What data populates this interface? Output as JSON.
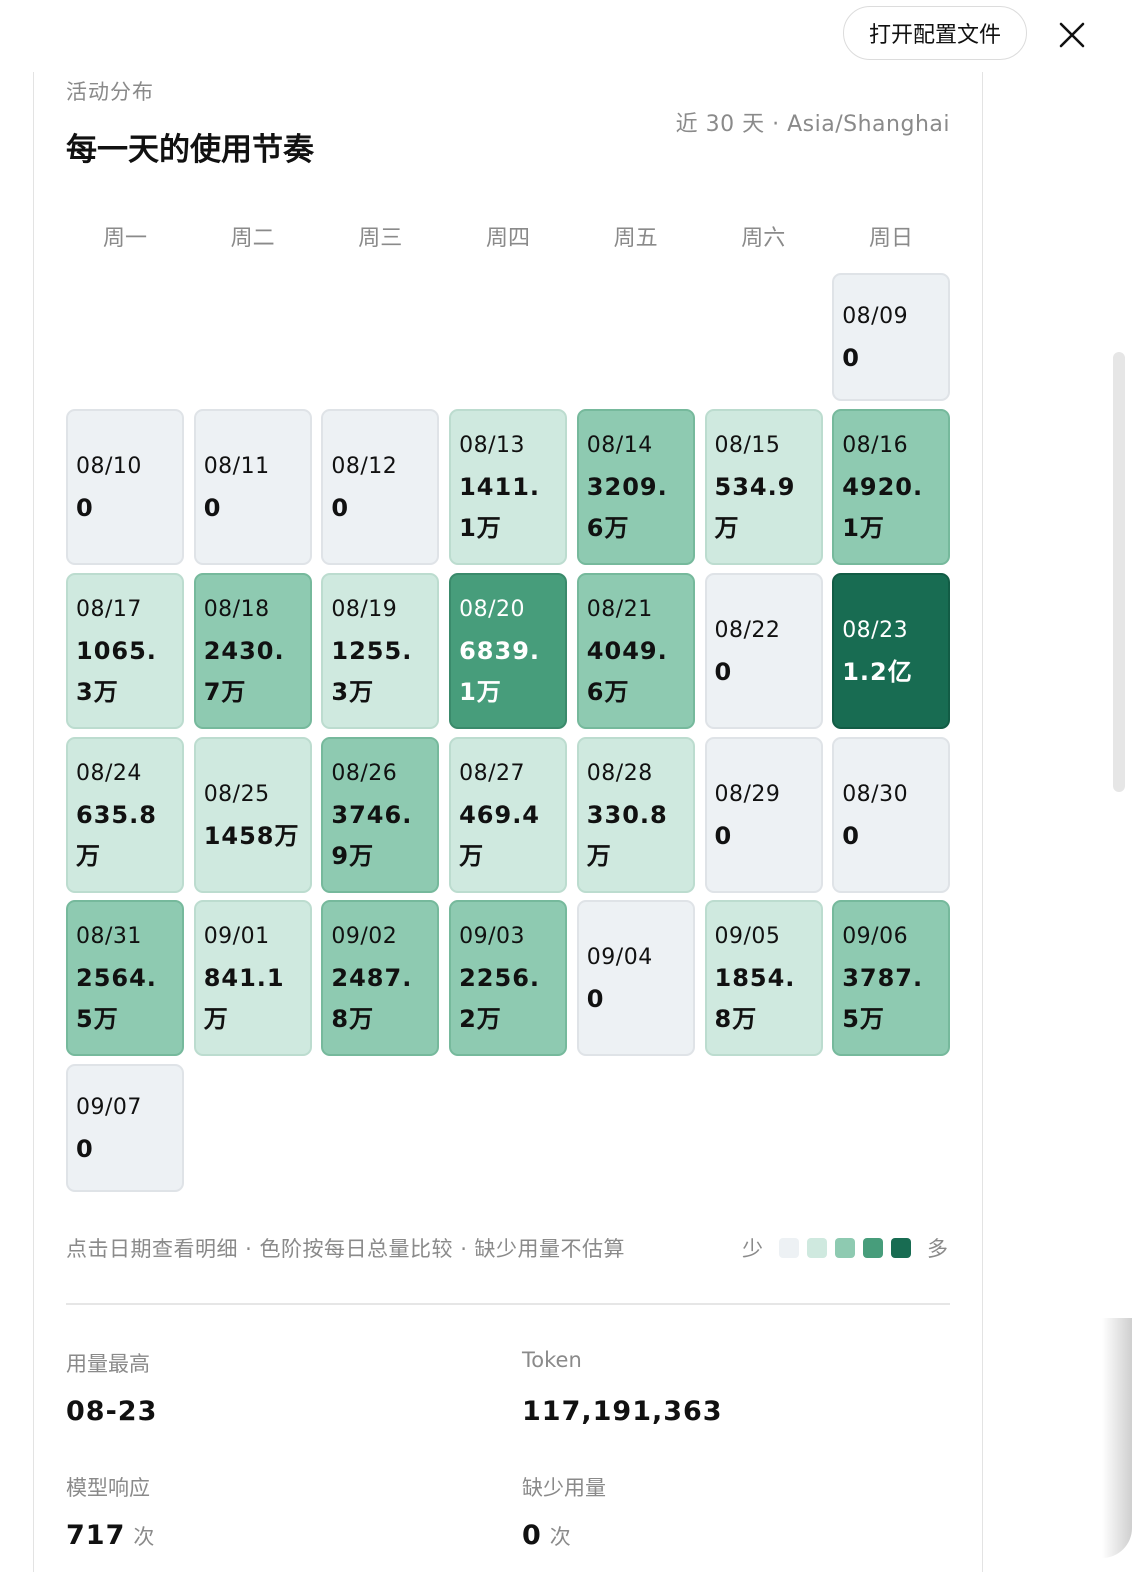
{
  "header": {
    "open_config_label": "打开配置文件",
    "close_icon": "close-icon"
  },
  "section": {
    "eyebrow": "活动分布",
    "title": "每一天的使用节奏",
    "range": "近 30 天 · Asia/Shanghai"
  },
  "weekdays": [
    "周一",
    "周二",
    "周三",
    "周四",
    "周五",
    "周六",
    "周日"
  ],
  "calendar": [
    {
      "date": "08/09",
      "value": "0",
      "level": 0
    },
    {
      "date": "08/10",
      "value": "0",
      "level": 0
    },
    {
      "date": "08/11",
      "value": "0",
      "level": 0
    },
    {
      "date": "08/12",
      "value": "0",
      "level": 0
    },
    {
      "date": "08/13",
      "value": "1411.1万",
      "level": 1
    },
    {
      "date": "08/14",
      "value": "3209.6万",
      "level": 2
    },
    {
      "date": "08/15",
      "value": "534.9万",
      "level": 1
    },
    {
      "date": "08/16",
      "value": "4920.1万",
      "level": 2
    },
    {
      "date": "08/17",
      "value": "1065.3万",
      "level": 1
    },
    {
      "date": "08/18",
      "value": "2430.7万",
      "level": 2
    },
    {
      "date": "08/19",
      "value": "1255.3万",
      "level": 1
    },
    {
      "date": "08/20",
      "value": "6839.1万",
      "level": 3
    },
    {
      "date": "08/21",
      "value": "4049.6万",
      "level": 2
    },
    {
      "date": "08/22",
      "value": "0",
      "level": 0
    },
    {
      "date": "08/23",
      "value": "1.2亿",
      "level": 4
    },
    {
      "date": "08/24",
      "value": "635.8万",
      "level": 1
    },
    {
      "date": "08/25",
      "value": "1458万",
      "level": 1
    },
    {
      "date": "08/26",
      "value": "3746.9万",
      "level": 2
    },
    {
      "date": "08/27",
      "value": "469.4万",
      "level": 1
    },
    {
      "date": "08/28",
      "value": "330.8万",
      "level": 1
    },
    {
      "date": "08/29",
      "value": "0",
      "level": 0
    },
    {
      "date": "08/30",
      "value": "0",
      "level": 0
    },
    {
      "date": "08/31",
      "value": "2564.5万",
      "level": 2
    },
    {
      "date": "09/01",
      "value": "841.1万",
      "level": 1
    },
    {
      "date": "09/02",
      "value": "2487.8万",
      "level": 2
    },
    {
      "date": "09/03",
      "value": "2256.2万",
      "level": 2
    },
    {
      "date": "09/04",
      "value": "0",
      "level": 0
    },
    {
      "date": "09/05",
      "value": "1854.8万",
      "level": 1
    },
    {
      "date": "09/06",
      "value": "3787.5万",
      "level": 2
    },
    {
      "date": "09/07",
      "value": "0",
      "level": 0
    }
  ],
  "footer": {
    "hint": "点击日期查看明细 · 色阶按每日总量比较 · 缺少用量不估算",
    "legend_less": "少",
    "legend_more": "多",
    "legend_colors": [
      "#edf1f4",
      "#cfe9df",
      "#8ecab1",
      "#479d7b",
      "#186c52"
    ]
  },
  "stats": {
    "peak_label": "用量最高",
    "peak_value": "08-23",
    "token_label": "Token",
    "token_value": "117,191,363",
    "responses_label": "模型响应",
    "responses_value": "717",
    "responses_unit": "次",
    "missing_label": "缺少用量",
    "missing_value": "0",
    "missing_unit": "次"
  }
}
